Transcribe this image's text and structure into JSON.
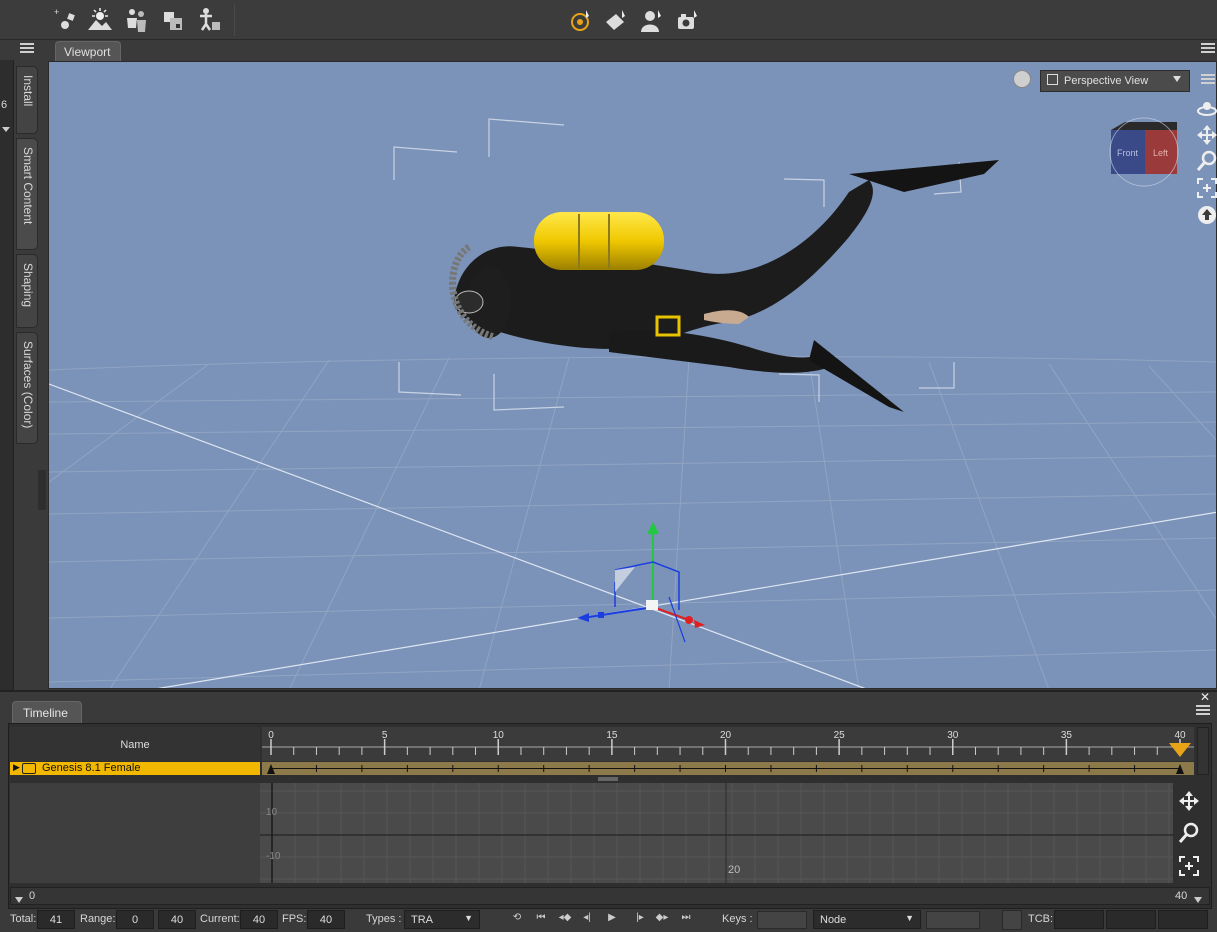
{
  "viewport": {
    "tab_label": "Viewport",
    "view_select": "Perspective View",
    "cube_labels": {
      "front": "Front",
      "left": "Left"
    }
  },
  "left_tabs": [
    {
      "label": "Install"
    },
    {
      "label": "Smart Content"
    },
    {
      "label": "Shaping"
    },
    {
      "label": "Surfaces (Color)"
    }
  ],
  "left_edge_number": "6",
  "timeline": {
    "tab_label": "Timeline",
    "name_header": "Name",
    "ruler_ticks": [
      "0",
      "5",
      "10",
      "15",
      "20",
      "25",
      "30",
      "35",
      "40"
    ],
    "track_name": "Genesis 8.1 Female",
    "graph_labels": {
      "upper": "10",
      "lower": "-10",
      "mid_x": "20"
    },
    "scroll_start": "0",
    "scroll_end": "40"
  },
  "bottom": {
    "total_label": "Total:",
    "total_value": "41",
    "range_label": "Range:",
    "range_start": "0",
    "range_end": "40",
    "current_label": "Current:",
    "current_value": "40",
    "fps_label": "FPS:",
    "fps_value": "40",
    "types_label": "Types :",
    "types_value": "TRA",
    "keys_label": "Keys :",
    "node_value": "Node",
    "tcb_label": "TCB:"
  },
  "colors": {
    "viewport_bg": "#7b93b9",
    "track_highlight": "#f2b800",
    "active_tool": "#e8a317"
  },
  "icons": {
    "toolbar": [
      "new-scene-icon",
      "render-icon",
      "figure-icon",
      "props-icon",
      "pose-icon",
      "universal-tool-icon",
      "surface-tool-icon",
      "figure-tool-icon",
      "camera-tool-icon"
    ],
    "viewport_nav": [
      "orbit-icon",
      "pan-icon",
      "zoom-icon",
      "frame-icon",
      "reset-view-icon"
    ]
  }
}
